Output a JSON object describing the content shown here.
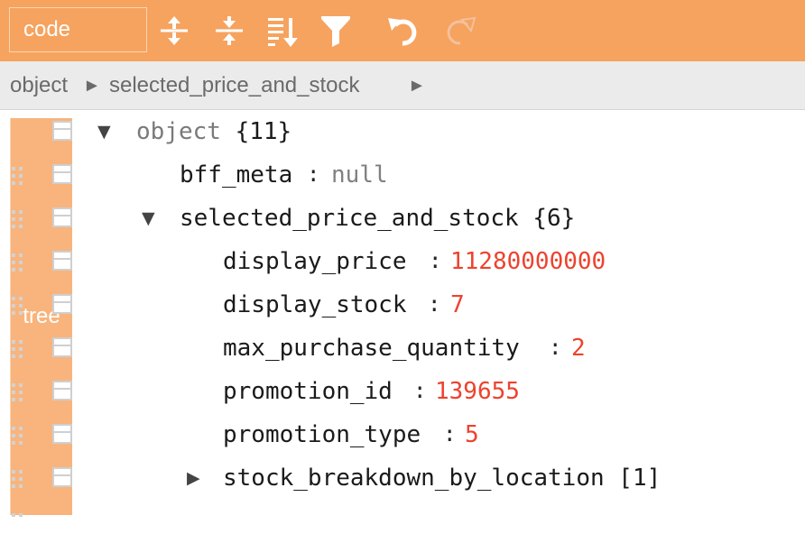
{
  "toolbar": {
    "modes": {
      "code": "code",
      "tree": "tree"
    },
    "icons": [
      "expand-all-icon",
      "collapse-all-icon",
      "sort-icon",
      "filter-icon",
      "undo-icon",
      "redo-icon"
    ],
    "colors": {
      "background": "#f6a35f",
      "active_mode": "#f8b47c"
    }
  },
  "breadcrumb": {
    "items": [
      "object",
      "selected_price_and_stock"
    ],
    "separator": "►"
  },
  "tree": {
    "root": {
      "label": "object",
      "count": "{11}"
    },
    "rows": [
      {
        "key": "bff_meta",
        "value": "null",
        "type": "null"
      },
      {
        "key": "selected_price_and_stock",
        "count": "{6}",
        "expanded": true
      },
      {
        "key": "display_price",
        "value": "11280000000",
        "type": "number"
      },
      {
        "key": "display_stock",
        "value": "7",
        "type": "number"
      },
      {
        "key": "max_purchase_quantity",
        "value": "2",
        "type": "number"
      },
      {
        "key": "promotion_id",
        "value": "139655",
        "type": "number"
      },
      {
        "key": "promotion_type",
        "value": "5",
        "type": "number"
      },
      {
        "key": "stock_breakdown_by_location",
        "count": "[1]",
        "expanded": false
      }
    ],
    "colors": {
      "number": "#ee422e",
      "null": "#808080",
      "key": "#1a1a1a"
    }
  }
}
